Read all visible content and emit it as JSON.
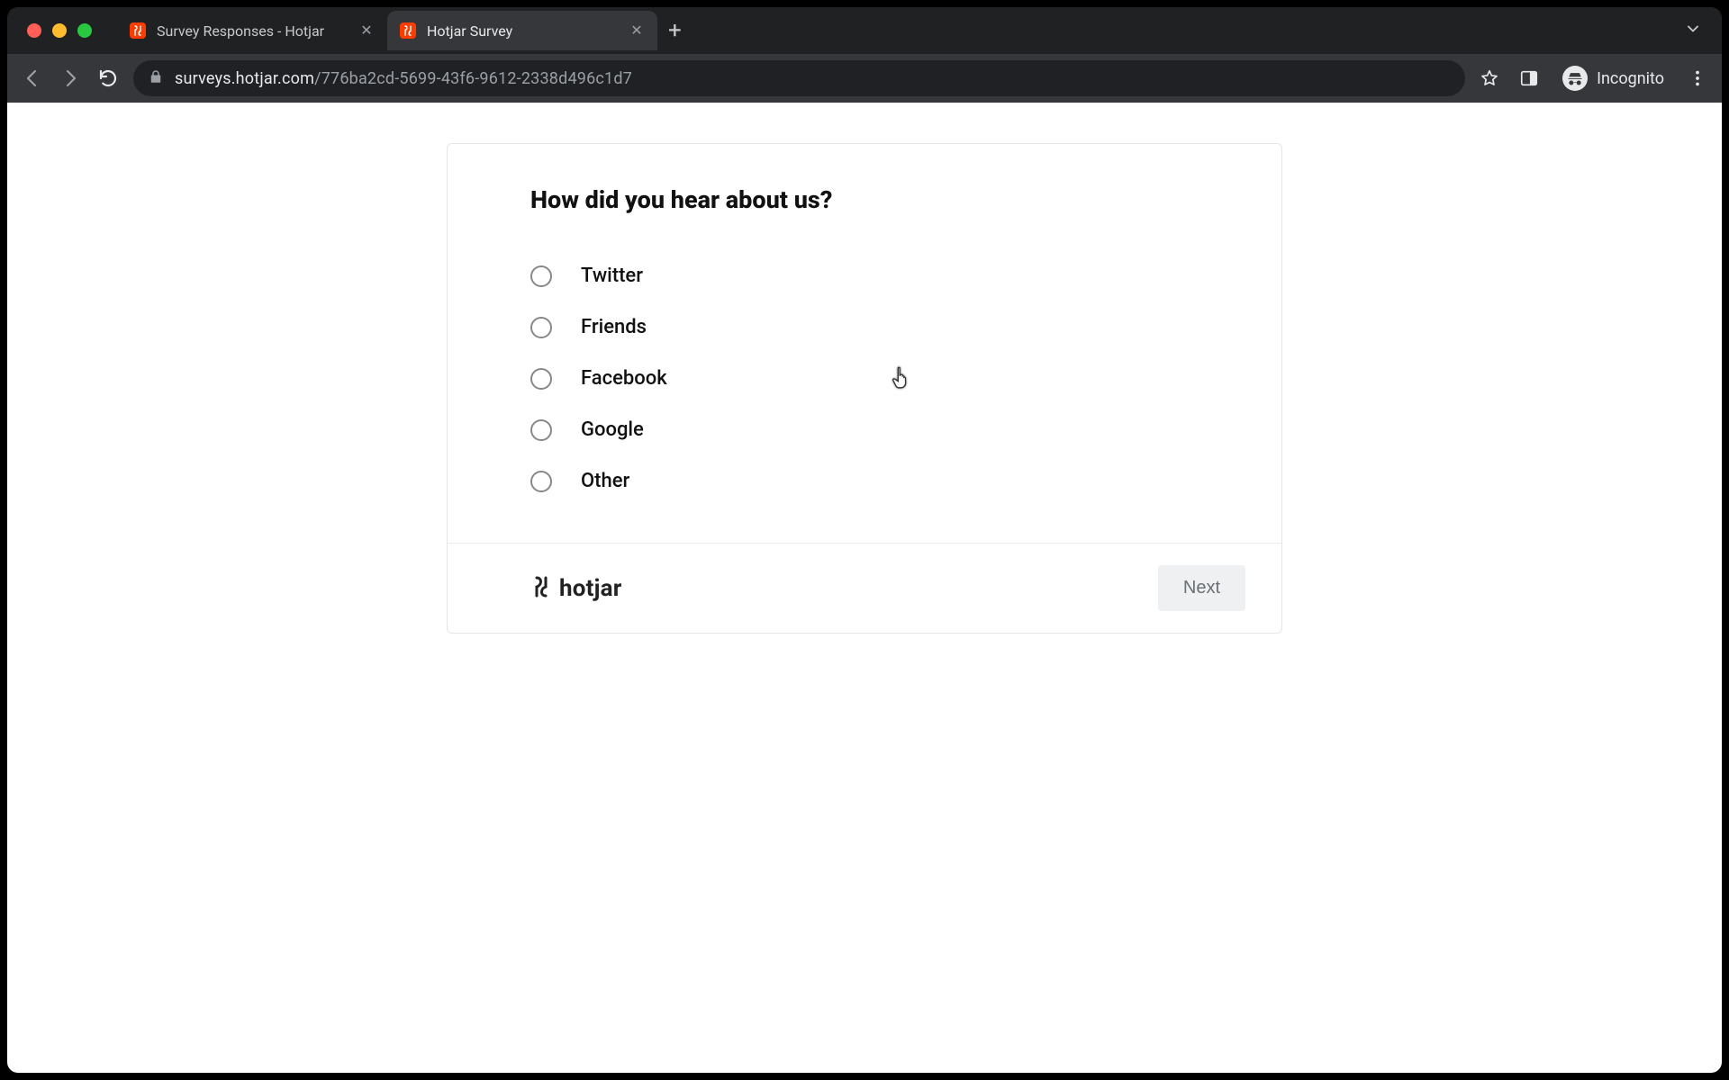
{
  "browser": {
    "tabs": [
      {
        "title": "Survey Responses - Hotjar",
        "active": false
      },
      {
        "title": "Hotjar Survey",
        "active": true
      }
    ],
    "url_domain": "surveys.hotjar.com",
    "url_path": "/776ba2cd-5699-43f6-9612-2338d496c1d7",
    "incognito_label": "Incognito"
  },
  "survey": {
    "question": "How did you hear about us?",
    "options": [
      "Twitter",
      "Friends",
      "Facebook",
      "Google",
      "Other"
    ],
    "next_label": "Next",
    "brand": "hotjar"
  }
}
